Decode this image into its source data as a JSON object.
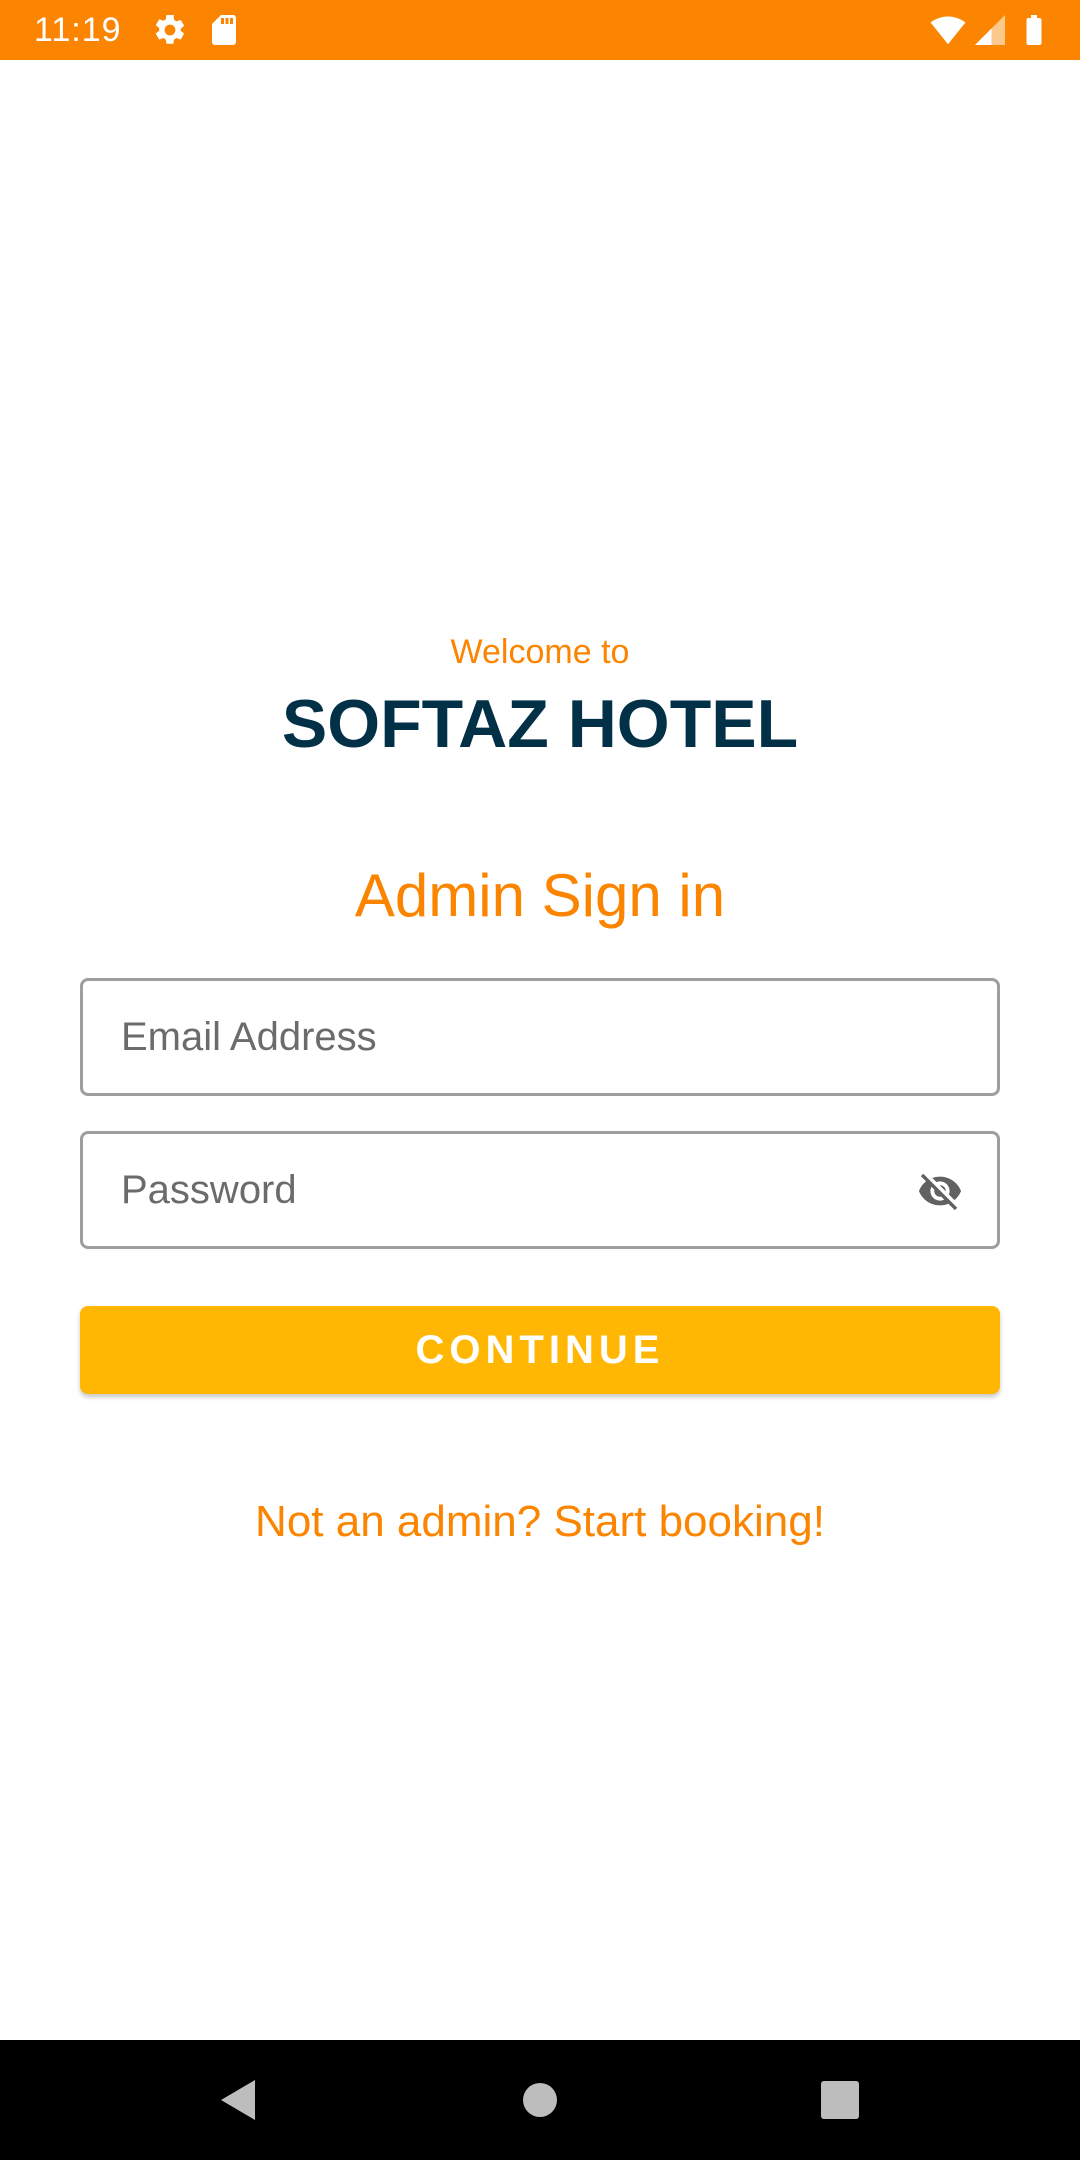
{
  "status_bar": {
    "time": "11:19",
    "background_color": "#FB8500",
    "icons": [
      "gear-icon",
      "sd-card-icon",
      "wifi-icon",
      "signal-icon",
      "battery-icon"
    ]
  },
  "header": {
    "welcome": "Welcome to",
    "hotel_name": "SOFTAZ HOTEL",
    "signin_title": "Admin Sign in"
  },
  "form": {
    "email_placeholder": "Email Address",
    "email_value": "",
    "password_placeholder": "Password",
    "password_value": "",
    "password_toggle_icon": "eye-off-icon",
    "continue_label": "CONTINUE"
  },
  "link": {
    "booking_text": "Not an admin? Start booking!"
  },
  "nav_bar": {
    "icons": [
      "back-icon",
      "home-icon",
      "recents-icon"
    ]
  },
  "colors": {
    "accent": "#FB8500",
    "title": "#023047",
    "button": "#FFB703"
  }
}
